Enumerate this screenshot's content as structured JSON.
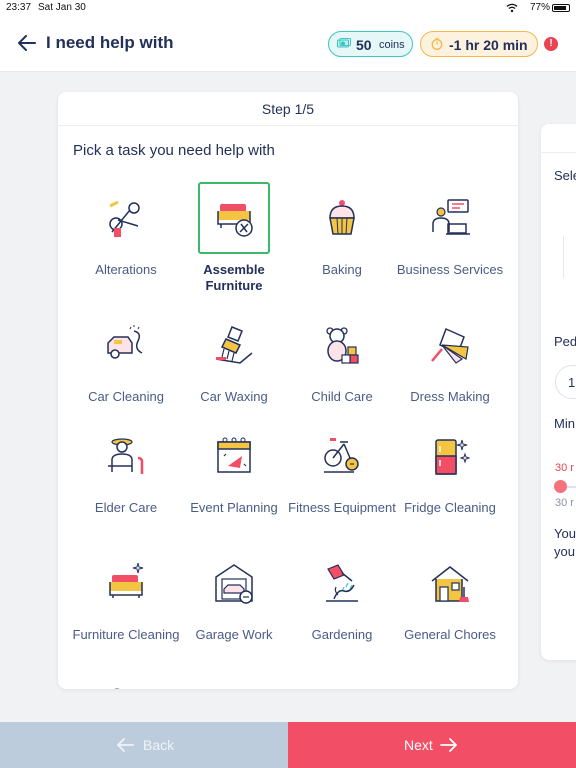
{
  "status_bar": {
    "time": "23:37",
    "date": "Sat Jan 30",
    "battery": "77%"
  },
  "header": {
    "title": "I need help with",
    "coins_value": "50",
    "coins_unit": "coins",
    "timer": "-1 hr 20 min",
    "alert": "!"
  },
  "card": {
    "step": "Step 1/5",
    "prompt": "Pick a task you need help with",
    "tasks": [
      {
        "label": "Alterations",
        "icon": "sewing-scissors-icon",
        "selected": false
      },
      {
        "label": "Assemble Furniture",
        "icon": "sofa-tools-icon",
        "selected": true
      },
      {
        "label": "Baking",
        "icon": "cupcake-icon",
        "selected": false
      },
      {
        "label": "Business Services",
        "icon": "laptop-person-icon",
        "selected": false
      },
      {
        "label": "Car Cleaning",
        "icon": "car-spray-icon",
        "selected": false
      },
      {
        "label": "Car Waxing",
        "icon": "car-wax-brush-icon",
        "selected": false
      },
      {
        "label": "Child Care",
        "icon": "teddy-bear-blocks-icon",
        "selected": false
      },
      {
        "label": "Dress Making",
        "icon": "fabric-swatches-icon",
        "selected": false
      },
      {
        "label": "Elder Care",
        "icon": "elder-with-cane-icon",
        "selected": false
      },
      {
        "label": "Event Planning",
        "icon": "calendar-party-icon",
        "selected": false
      },
      {
        "label": "Fitness Equipment",
        "icon": "exercise-bike-icon",
        "selected": false
      },
      {
        "label": "Fridge Cleaning",
        "icon": "fridge-sparkle-icon",
        "selected": false
      },
      {
        "label": "Furniture Cleaning",
        "icon": "sofa-sparkle-icon",
        "selected": false
      },
      {
        "label": "Garage Work",
        "icon": "garage-car-icon",
        "selected": false
      },
      {
        "label": "Gardening",
        "icon": "watering-can-icon",
        "selected": false
      },
      {
        "label": "General Chores",
        "icon": "house-broom-icon",
        "selected": false
      }
    ]
  },
  "side_card": {
    "sel_text": "Sele",
    "ped_text": "Ped",
    "num_value": "1",
    "min_text": "Min",
    "red_small": "30 r",
    "gray_small": "30 r",
    "you1": "You",
    "you2": "you"
  },
  "footer": {
    "back_label": "Back",
    "next_label": "Next"
  },
  "colors": {
    "accent": "#f24e66",
    "teal": "#3cc6c4",
    "amber": "#f3b84b",
    "selected_border": "#3db86a",
    "text_dark": "#22305a"
  }
}
